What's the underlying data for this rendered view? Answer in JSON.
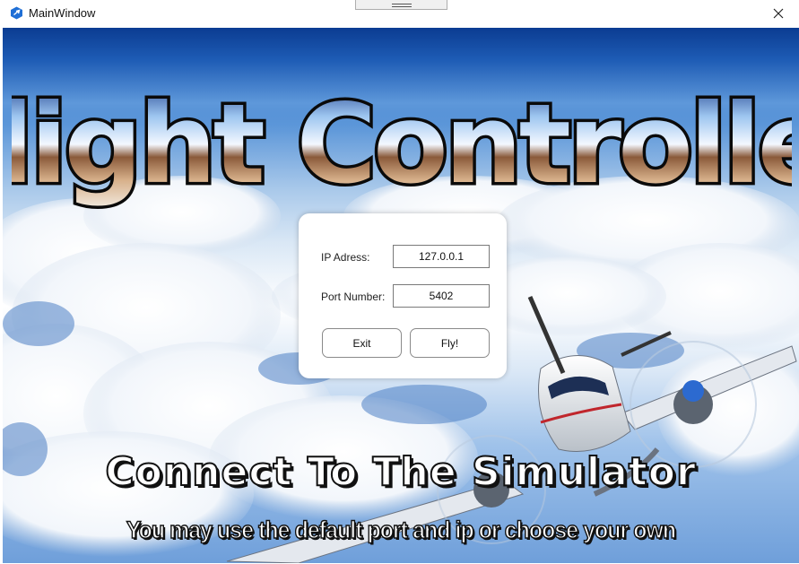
{
  "window": {
    "title": "MainWindow",
    "app_icon": "app-logo-icon",
    "close_icon": "close-icon"
  },
  "banner": {
    "title": "Flight Controller"
  },
  "form": {
    "ip_label": "IP Adress:",
    "ip_value": "127.0.0.1",
    "port_label": "Port Number:",
    "port_value": "5402",
    "exit_label": "Exit",
    "fly_label": "Fly!"
  },
  "captions": {
    "headline": "Connect To The Simulator",
    "subline": "You may use the default port and ip or choose your own"
  },
  "colors": {
    "sky_top": "#0d3f96",
    "sky_mid": "#5a95d8",
    "cloud": "#ffffff",
    "caption_text": "#ffffff",
    "caption_outline": "#111111"
  }
}
